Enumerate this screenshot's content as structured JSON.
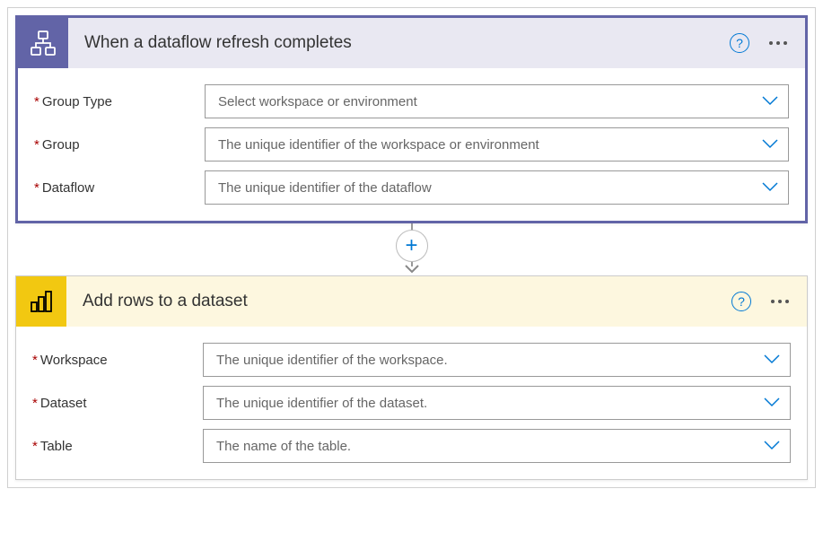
{
  "trigger": {
    "title": "When a dataflow refresh completes",
    "fields": [
      {
        "label": "Group Type",
        "placeholder": "Select workspace or environment"
      },
      {
        "label": "Group",
        "placeholder": "The unique identifier of the workspace or environment"
      },
      {
        "label": "Dataflow",
        "placeholder": "The unique identifier of the dataflow"
      }
    ]
  },
  "action": {
    "title": "Add rows to a dataset",
    "fields": [
      {
        "label": "Workspace",
        "placeholder": "The unique identifier of the workspace."
      },
      {
        "label": "Dataset",
        "placeholder": "The unique identifier of the dataset."
      },
      {
        "label": "Table",
        "placeholder": "The name of the table."
      }
    ]
  }
}
